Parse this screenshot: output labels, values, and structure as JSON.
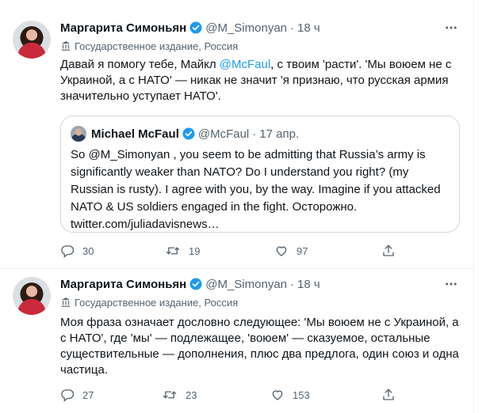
{
  "tweets": [
    {
      "author_name": "Маргарита Симоньян",
      "handle": "@M_Simonyan",
      "time": "18 ч",
      "label": "Государственное издание, Россия",
      "text_lines": [
        {
          "before": "Давай я помогу тебе, Майкл ",
          "mention": "@McFaul",
          "after": ", с твоим 'расти'. 'Мы воюем не с"
        },
        {
          "before": "Украиной, а с НАТО' — никак не значит 'я признаю, что русская армия",
          "mention": "",
          "after": ""
        },
        {
          "before": "значительно уступает НАТО'.",
          "mention": "",
          "after": ""
        }
      ],
      "quote": {
        "author_name": "Michael McFaul",
        "handle": "@McFaul",
        "time": "17 апр.",
        "text_lines": [
          "So @M_Simonyan , you seem to be admitting that Russia’s army is",
          "significantly weaker than NATO? Do I understand you right? (my",
          "Russian is rusty). I agree with you, by the way. Imagine if you attacked",
          "NATO & US soldiers engaged in the fight. Осторожно.",
          "twitter.com/juliadavisnews…"
        ]
      },
      "replies": "30",
      "retweets": "19",
      "likes": "97"
    },
    {
      "author_name": "Маргарита Симоньян",
      "handle": "@M_Simonyan",
      "time": "18 ч",
      "label": "Государственное издание, Россия",
      "text_lines": [
        "Моя фраза означает дословно следующее: 'Мы воюем не с Украиной, а",
        "с НАТО', где 'мы' — подлежащее, 'воюем' — сказуемое, остальные",
        "существительные — дополнения, плюс два предлога, один союз и одна",
        "частица."
      ],
      "replies": "27",
      "retweets": "23",
      "likes": "153"
    }
  ],
  "colors": {
    "accent": "#1d9bf0",
    "text_primary": "#0f1419",
    "text_secondary": "#536471",
    "border": "#cfd9de"
  },
  "icons": {
    "verified": "verified-badge-icon",
    "label": "government-building-icon",
    "more": "more-dots-icon",
    "reply": "reply-icon",
    "retweet": "retweet-icon",
    "like": "heart-icon",
    "share": "share-icon"
  }
}
